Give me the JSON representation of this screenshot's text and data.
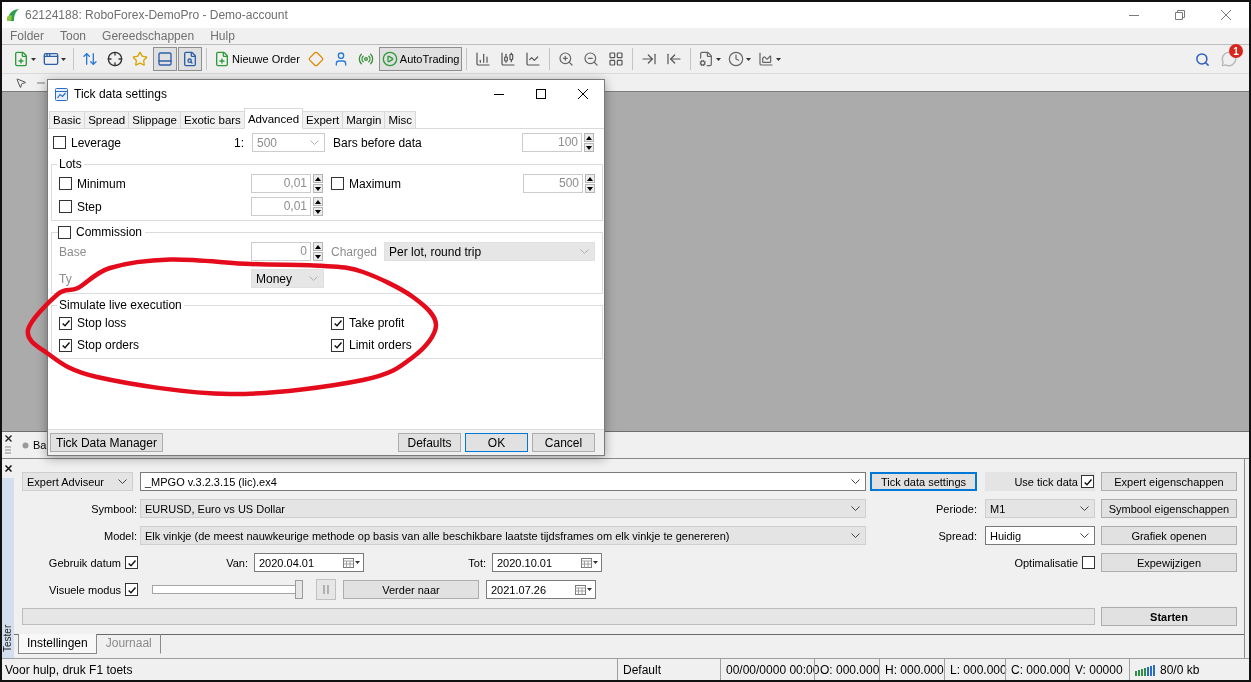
{
  "window": {
    "title": "62124188: RoboForex-DemoPro - Demo-account"
  },
  "menu": [
    "Folder",
    "Toon",
    "Gereedschappen",
    "Hulp"
  ],
  "toolbar": {
    "toggles": [
      {
        "on": false
      },
      {
        "on": false
      },
      {
        "on": false
      },
      {
        "on": true
      },
      {
        "on": true
      }
    ],
    "new_order": "Nieuwe Order",
    "autotrading": {
      "label": "AutoTrading",
      "on": true
    },
    "notification_count": "1"
  },
  "dialog": {
    "title": "Tick data settings",
    "tabs": [
      {
        "label": "Basic",
        "selected": false
      },
      {
        "label": "Spread",
        "selected": false
      },
      {
        "label": "Slippage",
        "selected": false
      },
      {
        "label": "Exotic bars",
        "selected": false
      },
      {
        "label": "Advanced",
        "selected": true
      },
      {
        "label": "Expert",
        "selected": false
      },
      {
        "label": "Margin",
        "selected": false
      },
      {
        "label": "Misc",
        "selected": false
      }
    ],
    "leverage": {
      "label": "Leverage",
      "checked": false,
      "prefix": "1:",
      "value": "500"
    },
    "bars_before_data": {
      "label": "Bars before data",
      "value": "100",
      "disabled": true
    },
    "lots": {
      "title": "Lots",
      "minimum": {
        "label": "Minimum",
        "checked": false,
        "value": "0,01"
      },
      "maximum": {
        "label": "Maximum",
        "checked": false,
        "value": "500"
      },
      "step": {
        "label": "Step",
        "checked": false,
        "value": "0,01"
      }
    },
    "commission": {
      "label": "Commission",
      "checked": false,
      "base": {
        "label": "Base",
        "value": "0"
      },
      "charged": {
        "label": "Charged",
        "value": "Per lot, round trip"
      },
      "type": {
        "label": "Ty",
        "value": "Money"
      }
    },
    "simulate_live_execution": {
      "title": "Simulate live execution",
      "options": [
        {
          "label": "Stop loss",
          "checked": true
        },
        {
          "label": "Take profit",
          "checked": true
        },
        {
          "label": "Stop orders",
          "checked": true
        },
        {
          "label": "Limit orders",
          "checked": true
        }
      ]
    },
    "buttons": [
      {
        "label": "Tick Data Manager",
        "focused": false
      },
      {
        "label": "Defaults",
        "focused": false
      },
      {
        "label": "OK",
        "focused": true
      },
      {
        "label": "Cancel",
        "focused": false
      }
    ]
  },
  "annotations": [
    {
      "kind": "ellipse"
    }
  ],
  "tester": {
    "header_tab": "Ba",
    "expert_type": {
      "value": "Expert Adviseur",
      "kind": "list"
    },
    "expert_file": {
      "value": "_MPGO v.3.2.3.15 (lic).ex4",
      "kind": "editable"
    },
    "tick_data_button": {
      "label": "Tick data settings",
      "focused": true
    },
    "use_tick_data": {
      "label": "Use tick data",
      "checked": true
    },
    "symbol": {
      "label": "Symbool:",
      "value": "EURUSD, Euro vs US Dollar",
      "kind": "list"
    },
    "period": {
      "label": "Periode:",
      "value": "M1",
      "kind": "list"
    },
    "model": {
      "label": "Model:",
      "value": "Elk vinkje (de meest nauwkeurige methode op basis van alle beschikbare laatste tijdsframes om elk vinkje te genereren)",
      "kind": "list"
    },
    "spread": {
      "label": "Spread:",
      "value": "Huidig",
      "kind": "editable"
    },
    "side_buttons": [
      "Expert eigenschappen",
      "Symbool eigenschappen",
      "Grafiek openen",
      "Expewijzigen"
    ],
    "use_date": {
      "label": "Gebruik datum",
      "checked": true
    },
    "from": {
      "label": "Van:",
      "value": "2020.04.01"
    },
    "to": {
      "label": "Tot:",
      "value": "2020.10.01"
    },
    "optimization": {
      "label": "Optimalisatie",
      "checked": false
    },
    "visual_mode": {
      "label": "Visuele modus",
      "checked": true
    },
    "speed": {
      "level": 1
    },
    "skip_button": "Verder naar",
    "skip_date": "2021.07.26",
    "progress": {
      "level": 0
    },
    "start_button": "Starten",
    "tabs": [
      {
        "label": "Instellingen",
        "selected": true
      },
      {
        "label": "Journaal",
        "selected": false
      }
    ],
    "side_label": "Tester"
  },
  "status_bar": {
    "help": "Voor hulp, druk F1 toets",
    "profile": "Default",
    "cells": [
      "00/00/0000 00:00",
      "O: 000.000",
      "H: 000.000",
      "L: 000.000",
      "C: 000.000",
      "V: 00000"
    ],
    "traffic": "80/0 kb"
  }
}
